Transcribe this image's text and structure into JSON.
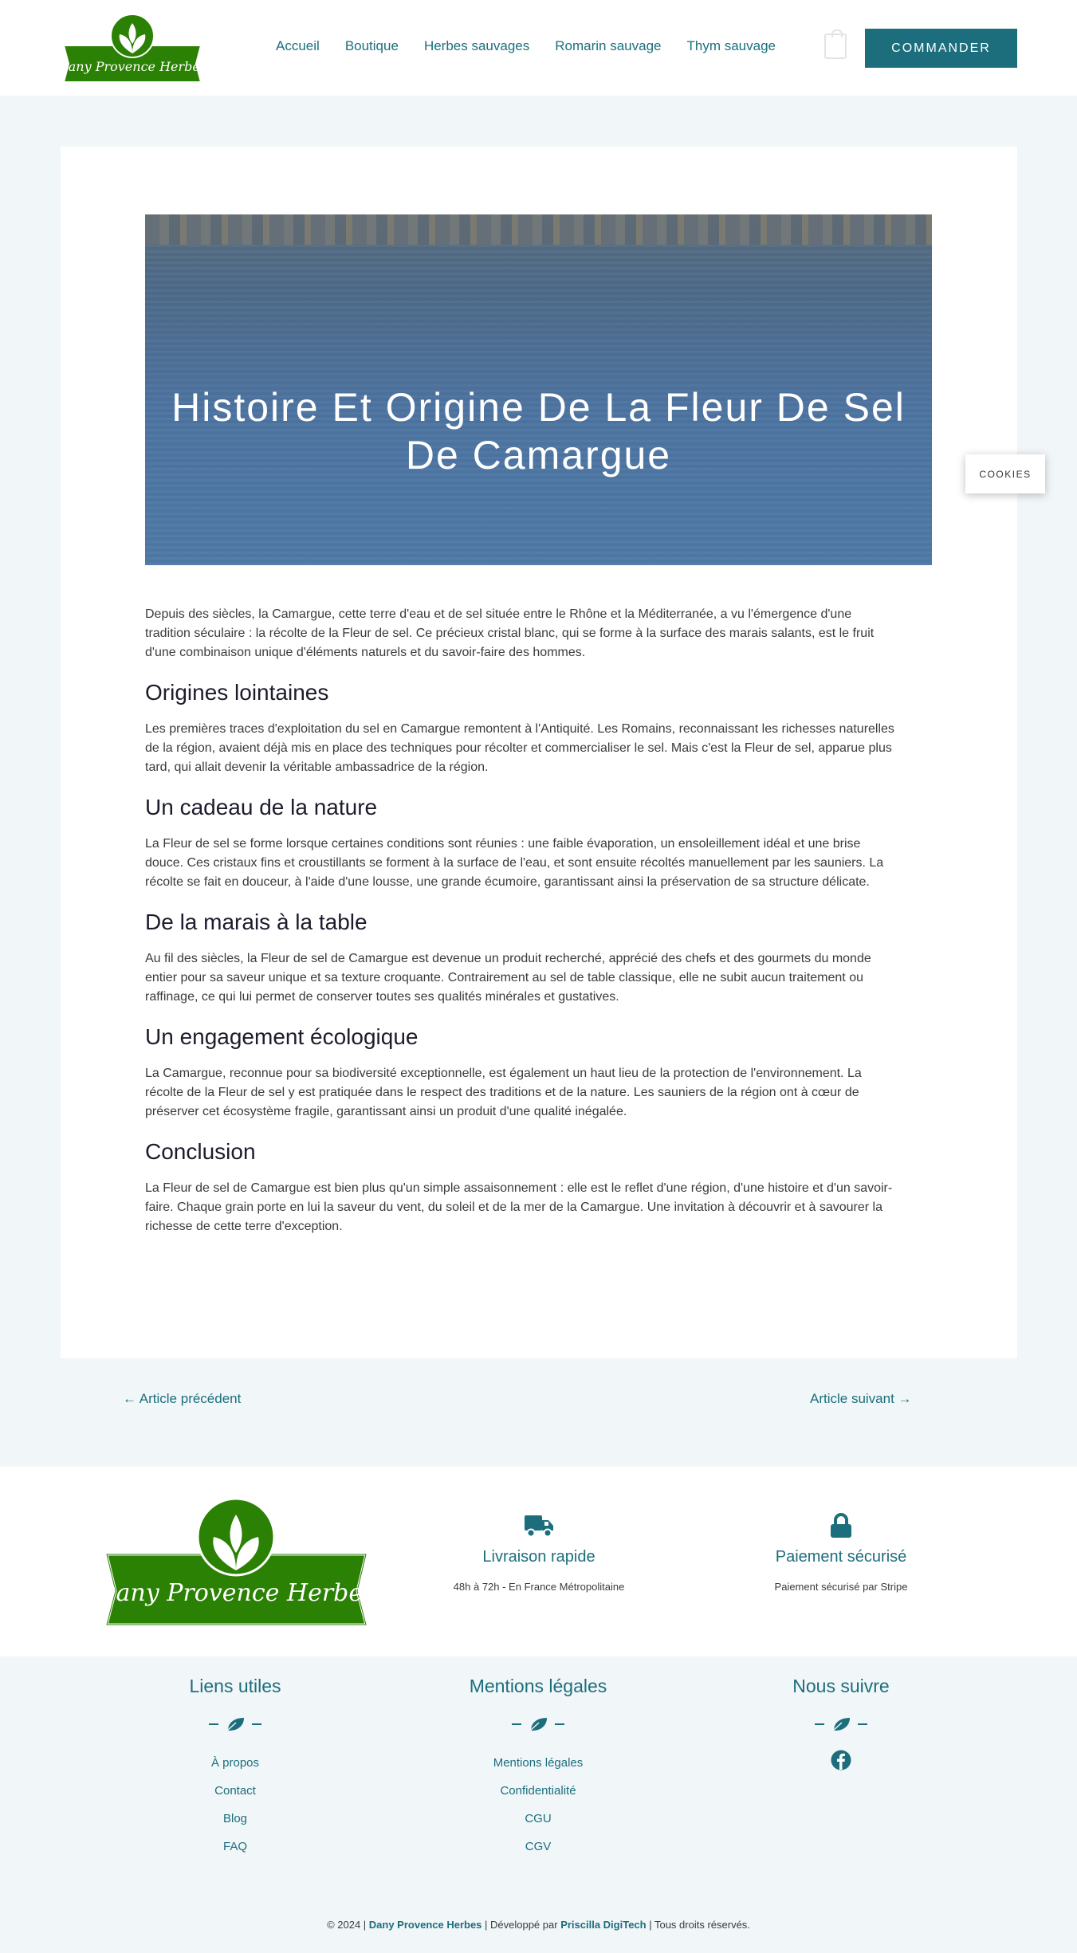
{
  "header": {
    "logo_text": "Dany Provence Herbes",
    "nav": [
      "Accueil",
      "Boutique",
      "Herbes sauvages",
      "Romarin sauvage",
      "Thym sauvage"
    ],
    "cta_label": "COMMANDER"
  },
  "article": {
    "title": "Histoire Et Origine De La Fleur De Sel De Camargue",
    "intro": "Depuis des siècles, la Camargue, cette terre d'eau et de sel située entre le Rhône et la Méditerranée, a vu l'émergence d'une tradition séculaire : la récolte de la Fleur de sel. Ce précieux cristal blanc, qui se forme à la surface des marais salants, est le fruit d'une combinaison unique d'éléments naturels et du savoir-faire des hommes.",
    "sections": [
      {
        "heading": "Origines lointaines",
        "text": "Les premières traces d'exploitation du sel en Camargue remontent à l'Antiquité. Les Romains, reconnaissant les richesses naturelles de la région, avaient déjà mis en place des techniques pour récolter et commercialiser le sel. Mais c'est la Fleur de sel, apparue plus tard, qui allait devenir la véritable ambassadrice de la région."
      },
      {
        "heading": "Un cadeau de la nature",
        "text": "La Fleur de sel se forme lorsque certaines conditions sont réunies : une faible évaporation, un ensoleillement idéal et une brise douce. Ces cristaux fins et croustillants se forment à la surface de l'eau, et sont ensuite récoltés manuellement par les sauniers. La récolte se fait en douceur, à l'aide d'une lousse, une grande écumoire, garantissant ainsi la préservation de sa structure délicate."
      },
      {
        "heading": "De la marais à la table",
        "text": "Au fil des siècles, la Fleur de sel de Camargue est devenue un produit recherché, apprécié des chefs et des gourmets du monde entier pour sa saveur unique et sa texture croquante. Contrairement au sel de table classique, elle ne subit aucun traitement ou raffinage, ce qui lui permet de conserver toutes ses qualités minérales et gustatives."
      },
      {
        "heading": "Un engagement écologique",
        "text": "La Camargue, reconnue pour sa biodiversité exceptionnelle, est également un haut lieu de la protection de l'environnement. La récolte de la Fleur de sel y est pratiquée dans le respect des traditions et de la nature. Les sauniers de la région ont à cœur de préserver cet écosystème fragile, garantissant ainsi un produit d'une qualité inégalée."
      },
      {
        "heading": "Conclusion",
        "text": "La Fleur de sel de Camargue est bien plus qu'un simple assaisonnement : elle est le reflet d'une région, d'une histoire et d'un savoir-faire. Chaque grain porte en lui la saveur du vent, du soleil et de la mer de la Camargue. Une invitation à découvrir et à savourer la richesse de cette terre d'exception."
      }
    ]
  },
  "cookies_label": "COOKIES",
  "post_nav": {
    "prev": "← Article précédent",
    "next": "Article suivant →"
  },
  "features": [
    {
      "icon": "truck-icon",
      "title": "Livraison rapide",
      "subtitle": "48h à 72h - En France Métropolitaine"
    },
    {
      "icon": "lock-icon",
      "title": "Paiement sécurisé",
      "subtitle": "Paiement sécurisé par Stripe"
    }
  ],
  "footer": {
    "columns": [
      {
        "title": "Liens utiles",
        "links": [
          "À propos",
          "Contact",
          "Blog",
          "FAQ"
        ]
      },
      {
        "title": "Mentions légales",
        "links": [
          "Mentions légales",
          "Confidentialité",
          "CGU",
          "CGV"
        ]
      },
      {
        "title": "Nous suivre",
        "links": []
      }
    ],
    "copyright": {
      "prefix": "© 2024 | ",
      "brand": "Dany Provence Herbes",
      "middle": " | Développé par ",
      "dev": "Priscilla DigiTech",
      "suffix": " | Tous droits réservés."
    }
  },
  "colors": {
    "accent": "#1c6e7d",
    "logo_green": "#2b8103",
    "background": "#f1f6f8"
  }
}
